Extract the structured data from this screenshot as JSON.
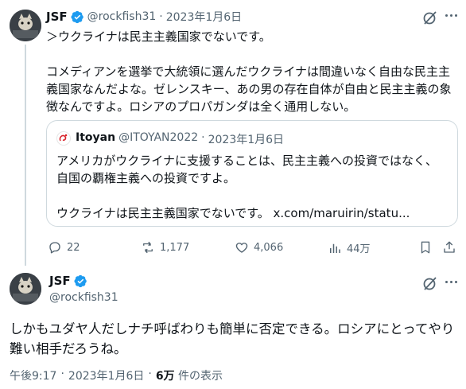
{
  "tweet1": {
    "name": "JSF",
    "handle": "@rockfish31",
    "separator": "·",
    "date": "2023年1月6日",
    "text": "＞ウクライナは民主主義国家でないです。\n\nコメディアンを選挙で大統領に選んだウクライナは間違いなく自由な民主主義国家なんだよな。ゼレンスキー、あの男の存在自体が自由と民主主義の象徴なんですよ。ロシアのプロパガンダは全く通用しない。",
    "quote": {
      "name": "Itoyan",
      "handle": "@ITOYAN2022",
      "separator": "·",
      "date": "2023年1月6日",
      "text": "アメリカがウクライナに支援することは、民主主義への投資ではなく、\n自国の覇権主義への投資ですよ。\n\nウクライナは民主主義国家でないです。 x.com/maruirin/statu..."
    },
    "actions": {
      "replies": "22",
      "retweets": "1,177",
      "likes": "4,066",
      "views": "44万"
    }
  },
  "tweet2": {
    "name": "JSF",
    "handle": "@rockfish31",
    "text": "しかもユダヤ人だしナチ呼ばわりも簡単に否定できる。ロシアにとってやり難い相手だろうね。",
    "time": "午後9:17",
    "separator": "·",
    "date": "2023年1月6日",
    "separator2": "·",
    "views_count": "6万",
    "views_label": " 件の表示"
  },
  "colors": {
    "verified": "#1d9bf0",
    "muted": "#536471",
    "border": "#cfd9de"
  },
  "icons": [
    "verified-badge-icon",
    "grok-icon",
    "reply-icon",
    "retweet-icon",
    "like-icon",
    "views-icon",
    "bookmark-icon",
    "share-icon"
  ]
}
